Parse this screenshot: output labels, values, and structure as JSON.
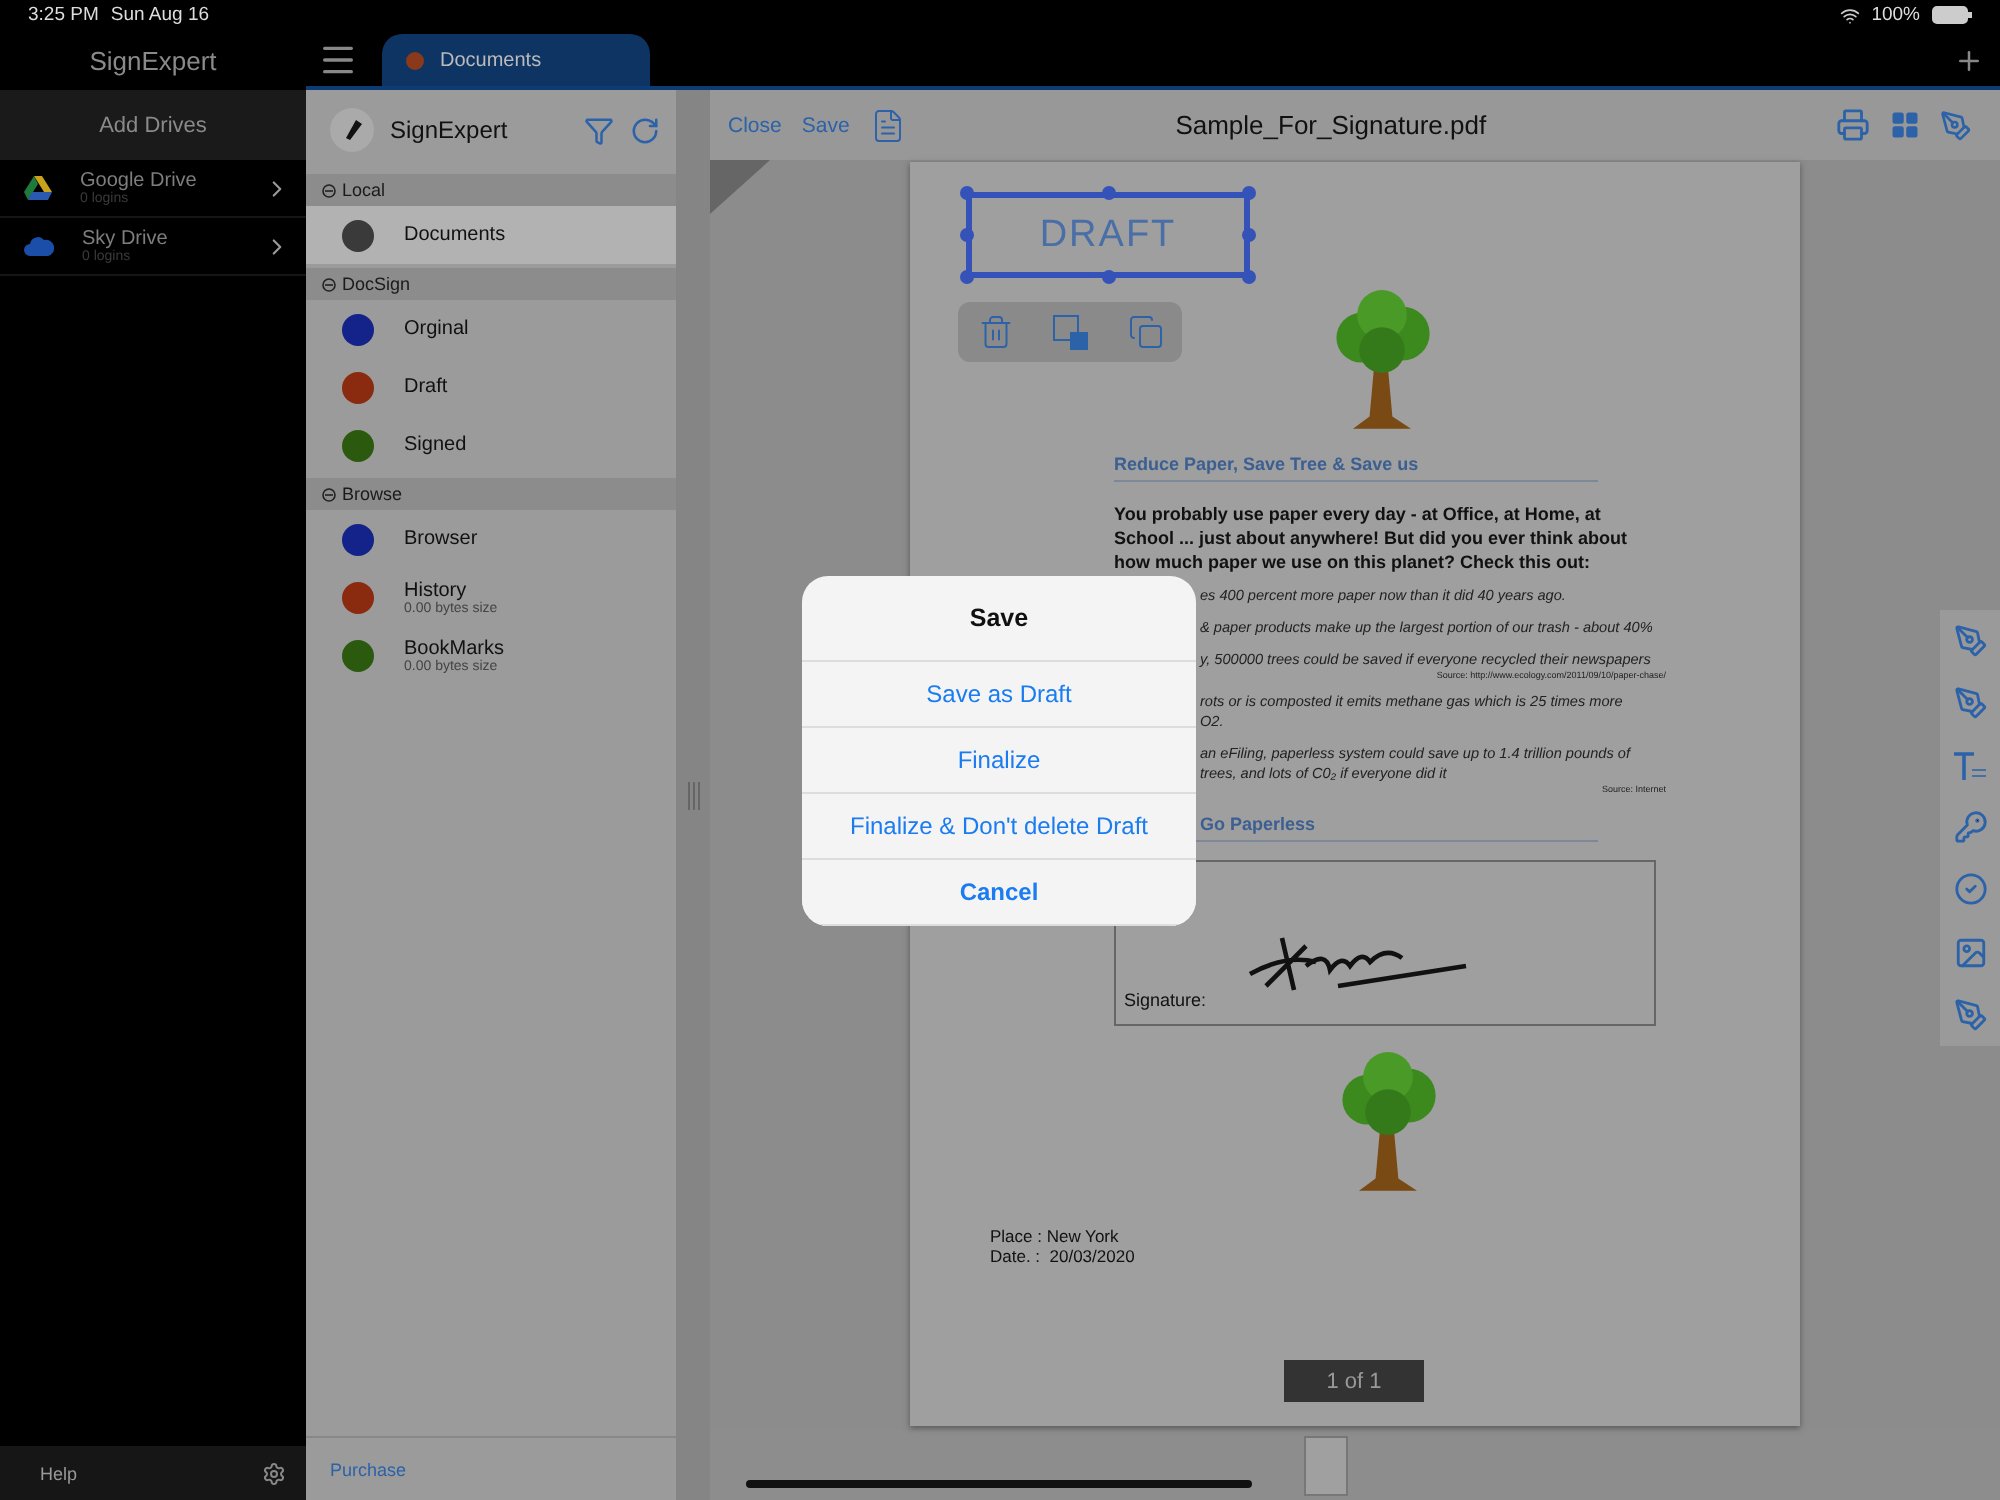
{
  "status_bar": {
    "time": "3:25 PM",
    "date": "Sun Aug 16",
    "battery": "100%"
  },
  "sidebar": {
    "app_title": "SignExpert",
    "add_drives": "Add Drives",
    "drives": [
      {
        "name": "Google Drive",
        "subtitle": "0 logins",
        "kind": "gdrive"
      },
      {
        "name": "Sky Drive",
        "subtitle": "0 logins",
        "kind": "cloud"
      }
    ],
    "help": "Help"
  },
  "tabs": [
    {
      "label": "Documents",
      "selected": true
    }
  ],
  "files_panel": {
    "title": "SignExpert",
    "sections": [
      {
        "title": "Local",
        "items": [
          {
            "name": "Documents",
            "color": "#3a3a3a",
            "selected": true
          }
        ]
      },
      {
        "title": "DocSign",
        "items": [
          {
            "name": "Orginal",
            "color": "#14238a",
            "selected": false
          },
          {
            "name": "Draft",
            "color": "#8a2a0e",
            "selected": false
          },
          {
            "name": "Signed",
            "color": "#2b5a0f",
            "selected": false
          }
        ]
      },
      {
        "title": "Browse",
        "items": [
          {
            "name": "Browser",
            "color": "#14238a",
            "selected": false
          },
          {
            "name": "History",
            "subtitle": "0.00 bytes size",
            "color": "#8a2a0e",
            "selected": false
          },
          {
            "name": "BookMarks",
            "subtitle": "0.00 bytes size",
            "color": "#2b5a0f",
            "selected": false
          }
        ]
      }
    ],
    "purchase": "Purchase"
  },
  "document": {
    "toolbar": {
      "close": "Close",
      "save": "Save",
      "filename": "Sample_For_Signature.pdf"
    },
    "stamp": "DRAFT",
    "heading": "Reduce Paper, Save Tree & Save us",
    "intro": "You probably use paper every day - at Office, at Home, at School ... just about anywhere! But did you ever think about how much paper we use on this planet? Check this out:",
    "facts": [
      {
        "lines": [
          "es 400 percent more paper now than it did 40 years ago."
        ]
      },
      {
        "lines": [
          "& paper products make up the largest portion of our trash - about 40%"
        ]
      },
      {
        "lines": [
          "y, 500000 trees could be saved if everyone recycled their newspapers"
        ],
        "source": "Source: http://www.ecology.com/2011/09/10/paper-chase/"
      },
      {
        "lines": [
          "rots or is composted it emits methane gas which is 25 times more",
          "O2."
        ]
      },
      {
        "lines": [
          "an eFiling, paperless system could save up to 1.4 trillion pounds of",
          "trees, and lots of C0₂ if everyone did it"
        ],
        "source": "Source: Internet"
      }
    ],
    "heading2": "Go Paperless",
    "signature_label": "Signature:",
    "place": "Place : New York",
    "date": "Date. :  20/03/2020",
    "page_indicator": "1 of 1"
  },
  "dialog": {
    "title": "Save",
    "actions": [
      {
        "label": "Save as Draft",
        "kind": "default"
      },
      {
        "label": "Finalize",
        "kind": "default"
      },
      {
        "label": "Finalize & Don't delete Draft",
        "kind": "default"
      },
      {
        "label": "Cancel",
        "kind": "cancel"
      }
    ]
  }
}
